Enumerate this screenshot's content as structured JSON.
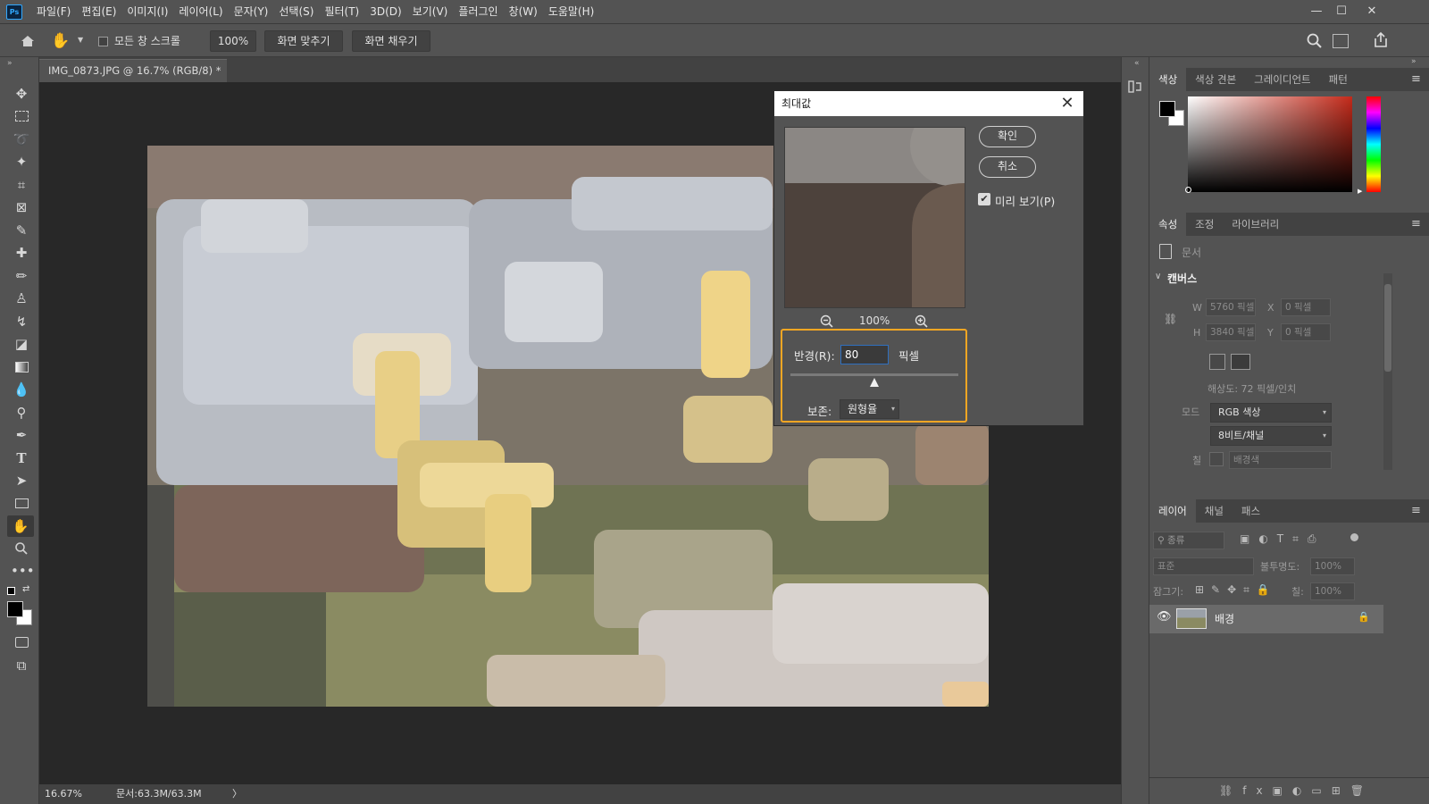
{
  "app": {
    "logo": "Ps"
  },
  "menu": [
    "파일(F)",
    "편집(E)",
    "이미지(I)",
    "레이어(L)",
    "문자(Y)",
    "선택(S)",
    "필터(T)",
    "3D(D)",
    "보기(V)",
    "플러그인",
    "창(W)",
    "도움말(H)"
  ],
  "window_controls": {
    "minimize": "—",
    "maximize": "☐",
    "close": "✕"
  },
  "options": {
    "scroll_all_label": "모든 창 스크롤",
    "zoom_value": "100%",
    "fit_screen": "화면 맞추기",
    "fill_screen": "화면 채우기"
  },
  "doc_tab": {
    "title": "IMG_0873.JPG @ 16.7% (RGB/8) *",
    "close": "×"
  },
  "status": {
    "zoom": "16.67%",
    "doc_size": "문서:63.3M/63.3M",
    "arrow": "〉"
  },
  "dialog": {
    "title": "최대값",
    "close": "✕",
    "ok": "확인",
    "cancel": "취소",
    "preview_label": "미리 보기(P)",
    "preview_checked": true,
    "zoom": "100%",
    "radius_label": "반경(R):",
    "radius_value": "80",
    "radius_unit": "픽셀",
    "slider_level_fraction": 0.5,
    "preserve_label": "보존:",
    "preserve_value": "원형율"
  },
  "color_panel": {
    "tabs": [
      "색상",
      "색상 견본",
      "그레이디언트",
      "패턴"
    ],
    "active": 0,
    "accent": "#c42a1a"
  },
  "properties_panel": {
    "tabs": [
      "속성",
      "조정",
      "라이브러리"
    ],
    "doc_label": "문서",
    "section": "캔버스",
    "w_label": "W",
    "w_value": "5760 픽셀",
    "h_label": "H",
    "h_value": "3840 픽셀",
    "x_label": "X",
    "x_value": "0 픽셀",
    "y_label": "Y",
    "y_value": "0 픽셀",
    "resolution": "해상도: 72 픽셀/인치",
    "mode_label": "모드",
    "mode_value": "RGB 색상",
    "bit_value": "8비트/채널",
    "fill_label": "칠",
    "fill_value": "배경색"
  },
  "layers_panel": {
    "tabs": [
      "레이어",
      "채널",
      "패스"
    ],
    "filter_label": "종류",
    "blend_mode": "표준",
    "opacity_label": "불투명도:",
    "opacity_value": "100%",
    "lock_label": "잠그기:",
    "fill_label": "칠:",
    "fill_value": "100%",
    "layers": [
      {
        "name": "배경",
        "visible": true,
        "locked": true
      }
    ]
  }
}
